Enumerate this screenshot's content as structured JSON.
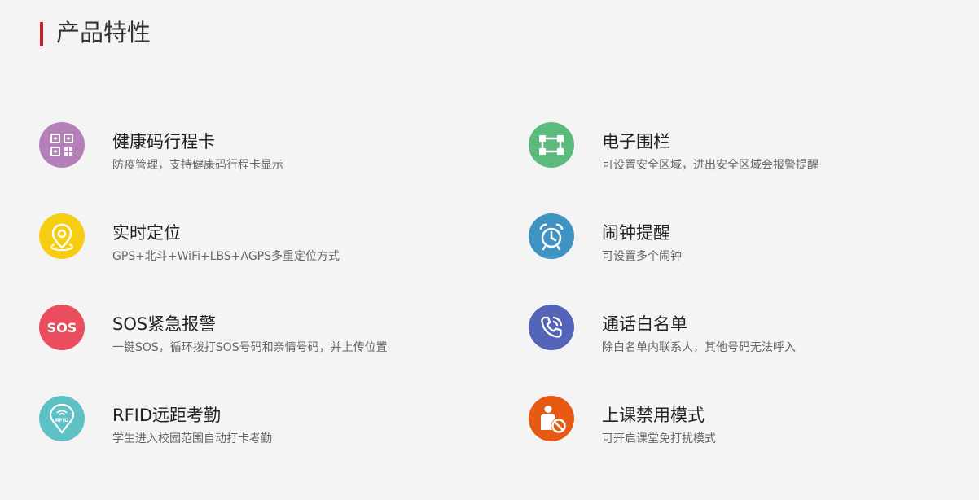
{
  "section": {
    "title": "产品特性"
  },
  "features": [
    {
      "title": "健康码行程卡",
      "desc": "防疫管理，支持健康码行程卡显示",
      "icon": "qr-code-icon",
      "color": "#b57fba"
    },
    {
      "title": "电子围栏",
      "desc": "可设置安全区域，进出安全区域会报警提醒",
      "icon": "fence-icon",
      "color": "#5dba7d"
    },
    {
      "title": "实时定位",
      "desc": "GPS+北斗+WiFi+LBS+AGPS多重定位方式",
      "icon": "location-pin-icon",
      "color": "#f7cd12"
    },
    {
      "title": "闹钟提醒",
      "desc": "可设置多个闹钟",
      "icon": "alarm-clock-icon",
      "color": "#3f93c3"
    },
    {
      "title": "SOS紧急报警",
      "desc": "一键SOS，循环拨打SOS号码和亲情号码，并上传位置",
      "icon": "sos-icon",
      "color": "#e94d5e",
      "icon_text": "SOS"
    },
    {
      "title": "通话白名单",
      "desc": "除白名单内联系人，其他号码无法呼入",
      "icon": "phone-call-icon",
      "color": "#5364b9"
    },
    {
      "title": "RFID远距考勤",
      "desc": "学生进入校园范围自动打卡考勤",
      "icon": "rfid-icon",
      "color": "#5ec1c6",
      "icon_text": "RFID"
    },
    {
      "title": "上课禁用模式",
      "desc": "可开启课堂免打扰模式",
      "icon": "class-disable-icon",
      "color": "#e75a14"
    }
  ]
}
